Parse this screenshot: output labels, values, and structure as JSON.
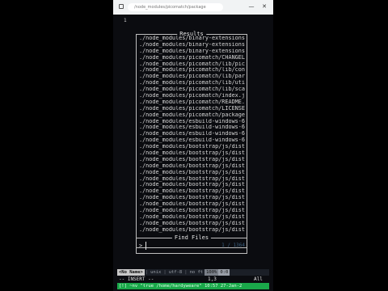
{
  "browser": {
    "url": "/node_modules/picomatch/package",
    "minimize_glyph": "—",
    "close_glyph": "✕"
  },
  "editor": {
    "line_number": "1"
  },
  "results_panel": {
    "title": "Results",
    "items": [
      "./node_modules/binary-extensions",
      "./node_modules/binary-extensions",
      "./node_modules/binary-extensions",
      "./node_modules/picomatch/CHANGEL",
      "./node_modules/picomatch/lib/pic",
      "./node_modules/picomatch/lib/con",
      "./node_modules/picomatch/lib/par",
      "./node_modules/picomatch/lib/uti",
      "./node_modules/picomatch/lib/sca",
      "./node_modules/picomatch/index.j",
      "./node_modules/picomatch/README.",
      "./node_modules/picomatch/LICENSE",
      "./node_modules/picomatch/package",
      "./node_modules/esbuild-windows-6",
      "./node_modules/esbuild-windows-6",
      "./node_modules/esbuild-windows-6",
      "./node_modules/esbuild-windows-6",
      "./node_modules/bootstrap/js/dist",
      "./node_modules/bootstrap/js/dist",
      "./node_modules/bootstrap/js/dist",
      "./node_modules/bootstrap/js/dist",
      "./node_modules/bootstrap/js/dist",
      "./node_modules/bootstrap/js/dist",
      "./node_modules/bootstrap/js/dist",
      "./node_modules/bootstrap/js/dist",
      "./node_modules/bootstrap/js/dist",
      "./node_modules/bootstrap/js/dist",
      "./node_modules/bootstrap/js/dist",
      "./node_modules/bootstrap/js/dist",
      "./node_modules/bootstrap/js/dist",
      "./node_modules/bootstrap/js/dist"
    ]
  },
  "find_panel": {
    "title": "Find Files",
    "prompt": ">",
    "count": "1 / 1364"
  },
  "statusline": {
    "mode": "<No Name>",
    "filetype": "unix",
    "encoding": "utf-8",
    "ft": "no ft",
    "percent": "100%",
    "position": "0:0"
  },
  "insert_line": {
    "mode_text": "-- INSERT --",
    "cursor_pos": "1,3",
    "scroll": "All"
  },
  "command_line": {
    "text": "[!] ~nv \"true /home/hardyweare\" 10:57 27-Jan-2"
  },
  "colors": {
    "terminal_bg": "#0b0c10",
    "accent_green": "#1aa84a",
    "count_blue": "#3b5f7f"
  }
}
